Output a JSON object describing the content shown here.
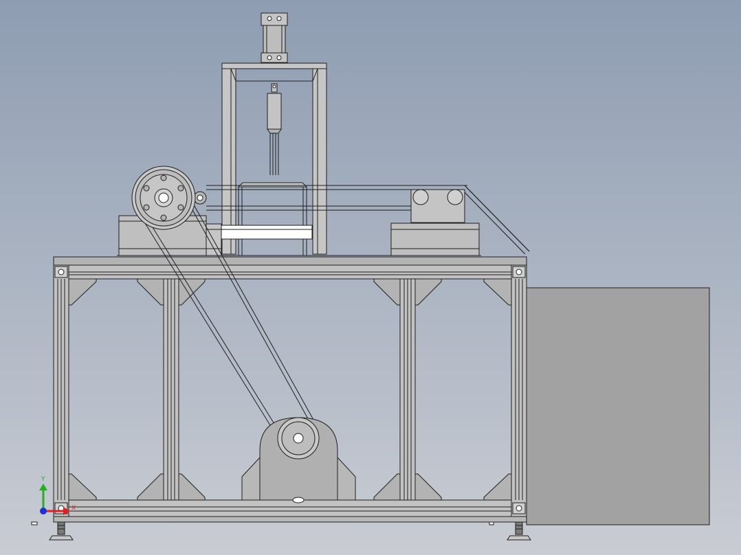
{
  "scene": {
    "background_top": "#8e9db2",
    "background_bottom": "#c9ccd3",
    "part_fill": "#b3b3b3",
    "part_fill_dark": "#9c9c9c",
    "panel_fill": "#a2a2a2",
    "edge_color": "#1e1e1e"
  },
  "triad": {
    "x_label": "X",
    "y_label": "Y",
    "x_color": "#e02020",
    "y_color": "#20b020",
    "z_color": "#2030d0"
  }
}
